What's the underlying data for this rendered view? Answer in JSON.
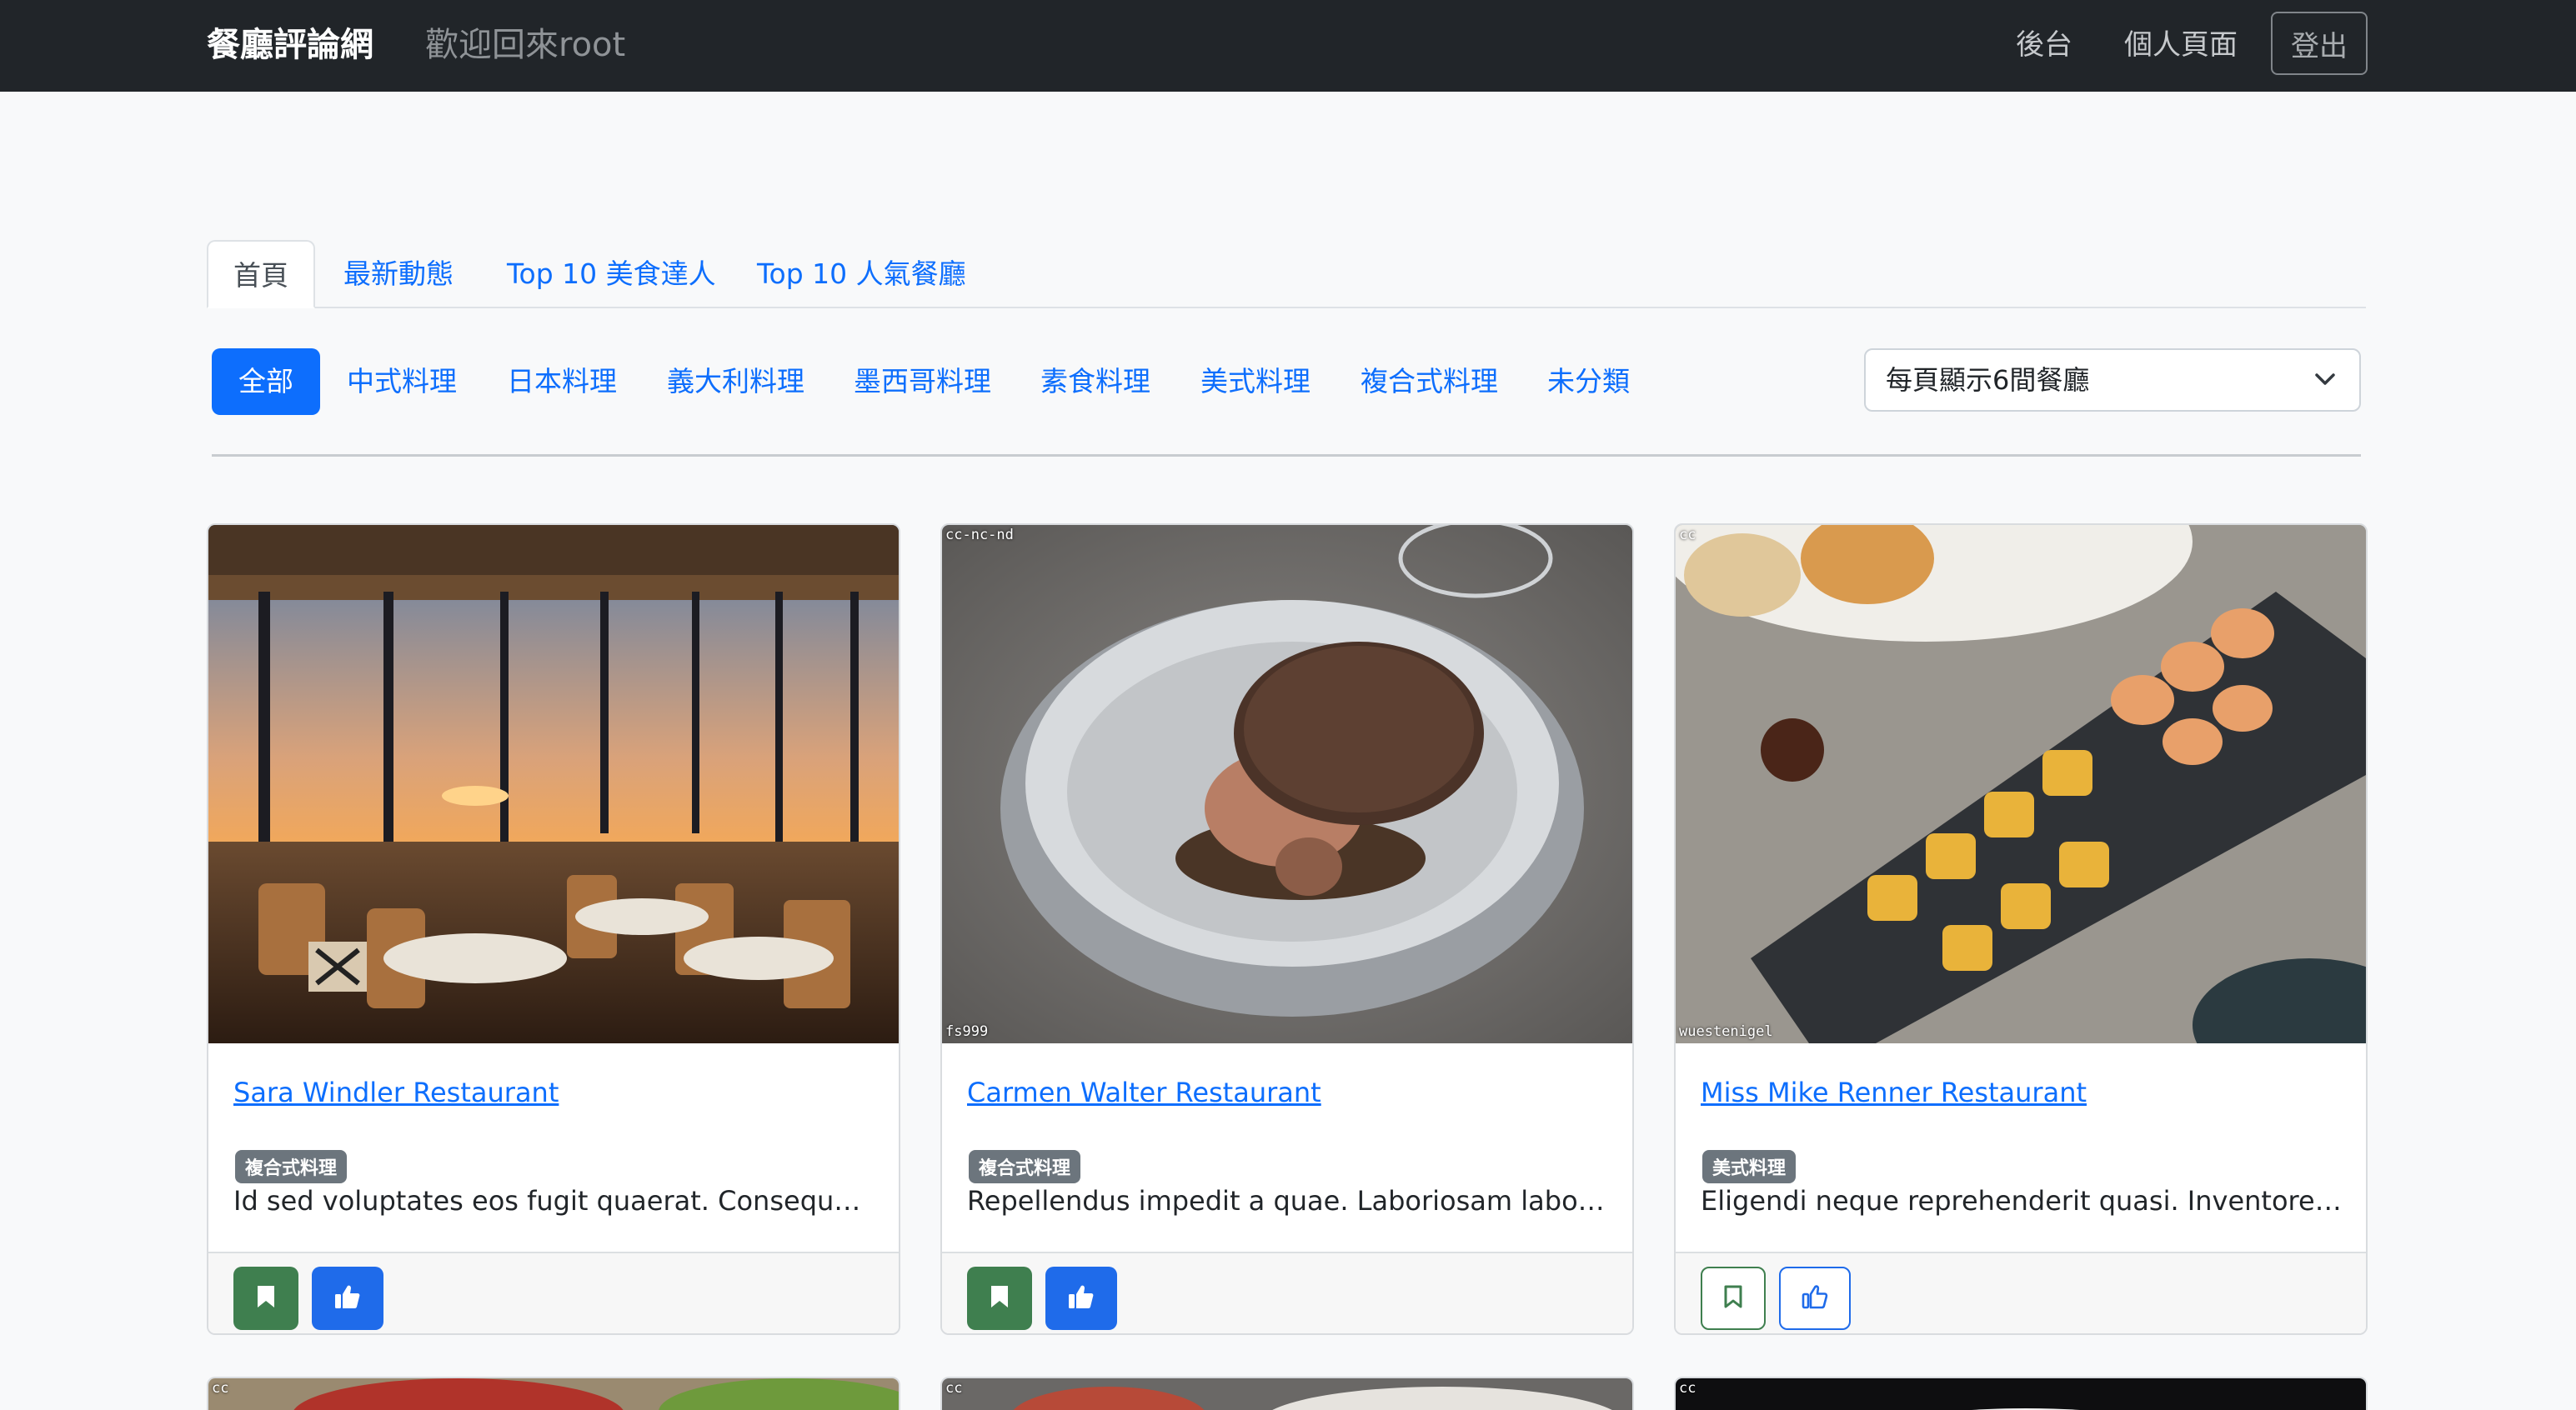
{
  "navbar": {
    "brand": "餐廳評論網",
    "welcome": "歡迎回來root",
    "links": [
      "後台",
      "個人頁面"
    ],
    "logout": "登出"
  },
  "tabs": [
    "首頁",
    "最新動態",
    "Top 10 美食達人",
    "Top 10 人氣餐廳"
  ],
  "categories": [
    "全部",
    "中式料理",
    "日本料理",
    "義大利料理",
    "墨西哥料理",
    "素食料理",
    "美式料理",
    "複合式料理",
    "未分類"
  ],
  "per_page_select": {
    "value": "每頁顯示6間餐廳"
  },
  "colors": {
    "primary": "#0d6efd",
    "navbar": "#212529",
    "favorite": "#3f7f4f",
    "badge": "#6c757d"
  },
  "cards": [
    {
      "title": "Sara Windler Restaurant",
      "category": "複合式料理",
      "description": "Id sed voluptates eos fugit quaerat. Consequatur r...",
      "watermarks": [],
      "favorited": true,
      "liked": true
    },
    {
      "title": "Carmen Walter Restaurant",
      "category": "複合式料理",
      "description": "Repellendus impedit a quae. Laboriosam labore ma...",
      "watermarks": [
        "cc-nc-nd",
        "fs999"
      ],
      "favorited": true,
      "liked": true
    },
    {
      "title": "Miss Mike Renner Restaurant",
      "category": "美式料理",
      "description": "Eligendi neque reprehenderit quasi. Inventore dolor...",
      "watermarks": [
        "cc",
        "wuestenigel"
      ],
      "favorited": false,
      "liked": false
    }
  ],
  "next_row_watermarks": [
    "cc",
    "cc",
    "cc"
  ],
  "icons": [
    "chevron-down-icon",
    "bookmark-icon",
    "thumbs-up-icon"
  ]
}
